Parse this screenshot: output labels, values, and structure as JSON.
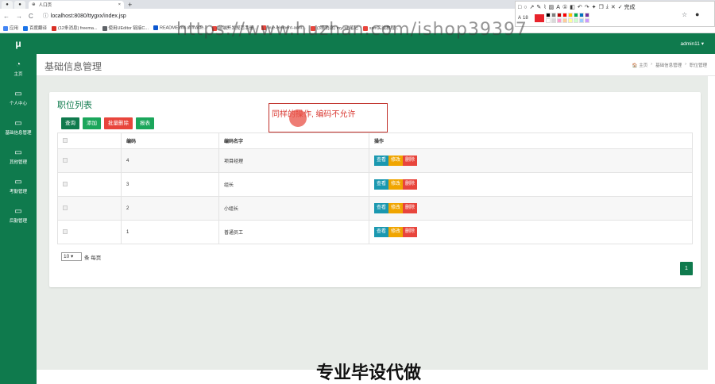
{
  "browser": {
    "tab_title": "人口页",
    "url": "localhost:8080/ttygxx/index.jsp",
    "bookmarks": [
      "应用",
      "百度翻译",
      "(12条消息) freema...",
      "使用UEditor 链接C...",
      "README.md at maste...",
      "前端开发规范手册...",
      "vue-element-adm...",
      "(3条消息) mycat 笔记",
      "ssm实战教程..."
    ]
  },
  "annotation_tool": {
    "done_label": "完成",
    "font_size": "18",
    "current_color": "#e8232b",
    "palette": [
      "#000000",
      "#7f7f7f",
      "#c00000",
      "#ff0000",
      "#ffc000",
      "#00b050",
      "#0070c0",
      "#7030a0",
      "#ffffff",
      "#d9d9d9",
      "#ff99cc",
      "#ffcc99",
      "#ffff99",
      "#ccffcc",
      "#99ccff",
      "#cc99ff"
    ]
  },
  "watermark": "https://www.huzhan.com/ishop39397",
  "app": {
    "logo": "μ",
    "accent": "#0f7a4d",
    "user_menu": "admin11 ▾",
    "nav": [
      {
        "label": "主页",
        "icon": "dashboard-icon"
      },
      {
        "label": "个人中心",
        "icon": "monitor-icon"
      },
      {
        "label": "基础信息管理",
        "icon": "monitor-icon"
      },
      {
        "label": "其他管理",
        "icon": "monitor-icon"
      },
      {
        "label": "考勤管理",
        "icon": "monitor-icon"
      },
      {
        "label": "后勤管理",
        "icon": "monitor-icon"
      }
    ],
    "page_title": "基础信息管理",
    "breadcrumb": [
      "🏠 主页",
      "›",
      "基础信息管理",
      "›",
      "职位管理"
    ]
  },
  "card": {
    "title": "职位列表",
    "buttons": {
      "search": "查询",
      "add": "添加",
      "batch_delete": "批量删除",
      "report": "报表"
    },
    "columns": [
      "",
      "编码",
      "编码名字",
      "操作"
    ],
    "rows": [
      {
        "code": "4",
        "name": "项目经理"
      },
      {
        "code": "3",
        "name": "组长"
      },
      {
        "code": "2",
        "name": "小组长"
      },
      {
        "code": "1",
        "name": "普通员工"
      }
    ],
    "actions": {
      "view": "查看",
      "edit": "修改",
      "delete": "删除"
    },
    "page_size": "10",
    "per_page_label": "条 每页",
    "current_page": "1"
  },
  "annotation_note": "同样的操作, 编码不允许",
  "banner": "专业毕设代做"
}
